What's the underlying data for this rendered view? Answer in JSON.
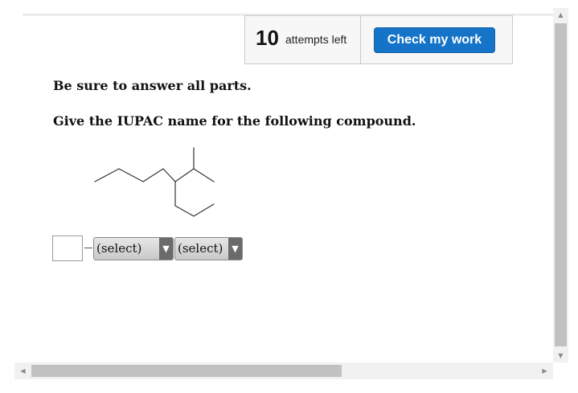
{
  "header": {
    "attempts_count": "10",
    "attempts_label": "attempts left",
    "check_button_label": "Check my work"
  },
  "question": {
    "instruction": "Be sure to answer all parts.",
    "prompt": "Give the IUPAC name for the following compound."
  },
  "answer": {
    "number_value": "",
    "select1_value": "(select)",
    "select2_value": "(select)"
  },
  "icons": {
    "select_arrow": "▼",
    "scroll_up": "▲",
    "scroll_down": "▼",
    "scroll_left": "◀",
    "scroll_right": "▶"
  },
  "colors": {
    "accent": "#1674c8",
    "select_arrow_bg": "#6b6b6b",
    "scroll_thumb": "#c1c1c1"
  }
}
